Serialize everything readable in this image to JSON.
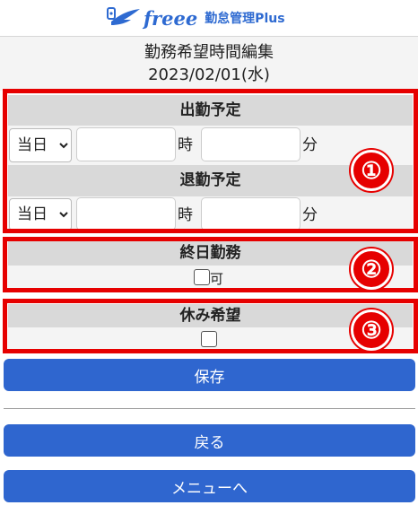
{
  "brand": {
    "logo_text": "freee",
    "product": "勤怠管理Plus",
    "color": "#2e6ad1"
  },
  "page": {
    "title": "勤務希望時間編集",
    "date": "2023/02/01(水)"
  },
  "sections": {
    "start": {
      "heading": "出勤予定",
      "day_select": "当日",
      "hour_value": "",
      "hour_unit": "時",
      "minute_value": "",
      "minute_unit": "分"
    },
    "end": {
      "heading": "退勤予定",
      "day_select": "当日",
      "hour_value": "",
      "hour_unit": "時",
      "minute_value": "",
      "minute_unit": "分"
    },
    "all_day": {
      "heading": "終日勤務",
      "checkbox_label": "可",
      "checked": false
    },
    "day_off": {
      "heading": "休み希望",
      "checked": false
    }
  },
  "annotations": {
    "markers": [
      "①",
      "②",
      "③"
    ],
    "color": "#e60000"
  },
  "buttons": {
    "save": "保存",
    "back": "戻る",
    "menu": "メニューへ"
  },
  "colors": {
    "button": "#2f66cf"
  }
}
